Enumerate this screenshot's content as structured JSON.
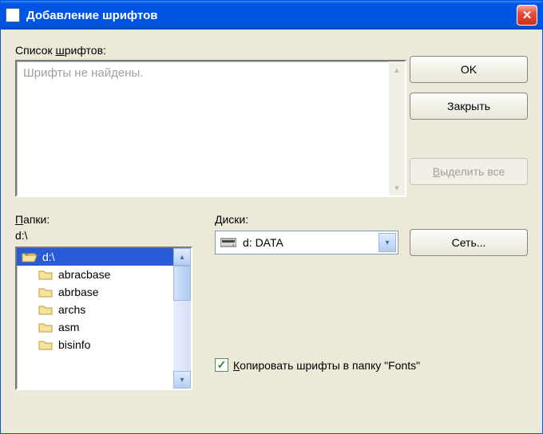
{
  "title": "Добавление шрифтов",
  "fontlist_label_pre": "Список ",
  "fontlist_label_u": "ш",
  "fontlist_label_post": "рифтов:",
  "fontlist_placeholder": "Шрифты не найдены.",
  "buttons": {
    "ok": "OK",
    "close": "Закрыть",
    "select_all_u": "В",
    "select_all_post": "ыделить все",
    "network": "Сеть..."
  },
  "folders_label_u": "П",
  "folders_label_post": "апки:",
  "current_path": "d:\\",
  "folder_items": [
    {
      "label": "d:\\",
      "selected": true,
      "open": true,
      "child": false
    },
    {
      "label": "abracbase",
      "selected": false,
      "open": false,
      "child": true
    },
    {
      "label": "abrbase",
      "selected": false,
      "open": false,
      "child": true
    },
    {
      "label": "archs",
      "selected": false,
      "open": false,
      "child": true
    },
    {
      "label": "asm",
      "selected": false,
      "open": false,
      "child": true
    },
    {
      "label": "bisinfo",
      "selected": false,
      "open": false,
      "child": true
    }
  ],
  "drives_label_u": "Д",
  "drives_label_post": "иски:",
  "drive_selected": "d: DATA",
  "copy_checkbox_u": "К",
  "copy_checkbox_post": "опировать шрифты в папку \"Fonts\"",
  "copy_checked": true
}
